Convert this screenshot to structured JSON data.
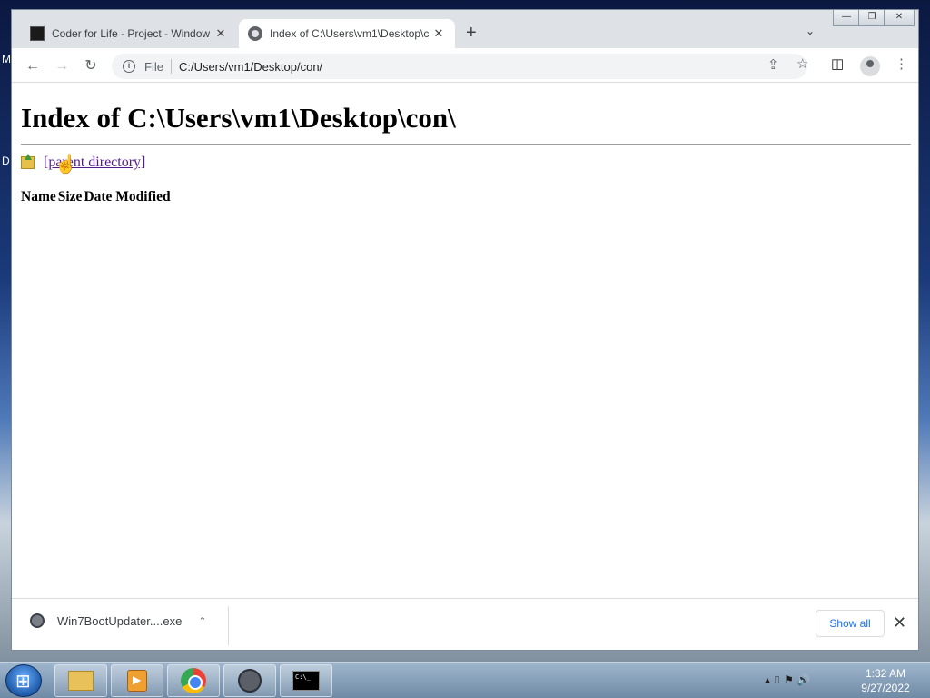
{
  "desktop": {
    "label_m": "M",
    "label_d": "D"
  },
  "tabs": [
    {
      "title": "Coder for Life - Project - Window",
      "close": "✕"
    },
    {
      "title": "Index of C:\\Users\\vm1\\Desktop\\c",
      "close": "✕"
    }
  ],
  "toolbar": {
    "new_tab": "+",
    "tab_search": "⌄",
    "back": "←",
    "forward": "→",
    "reload": "↻",
    "scheme": "File",
    "url": "C:/Users/vm1/Desktop/con/",
    "share": "⇪",
    "bookmark": "☆",
    "side_panel": "◫",
    "menu": "⋮"
  },
  "window_controls": {
    "minimize": "—",
    "restore": "❐",
    "close": "✕"
  },
  "page": {
    "heading": "Index of C:\\Users\\vm1\\Desktop\\con\\",
    "parent_link": "[parent directory]",
    "columns": [
      "Name",
      "Size",
      "Date Modified"
    ]
  },
  "downloads": {
    "filename": "Win7BootUpdater....exe",
    "chevron": "⌃",
    "show_all": "Show all",
    "close": "✕"
  },
  "taskbar": {
    "cmd_label": "C:\\_",
    "tray_icons": "▴  ⎍  ⚑  🔊",
    "time": "1:32 AM",
    "date": "9/27/2022"
  },
  "cursor": "☝"
}
